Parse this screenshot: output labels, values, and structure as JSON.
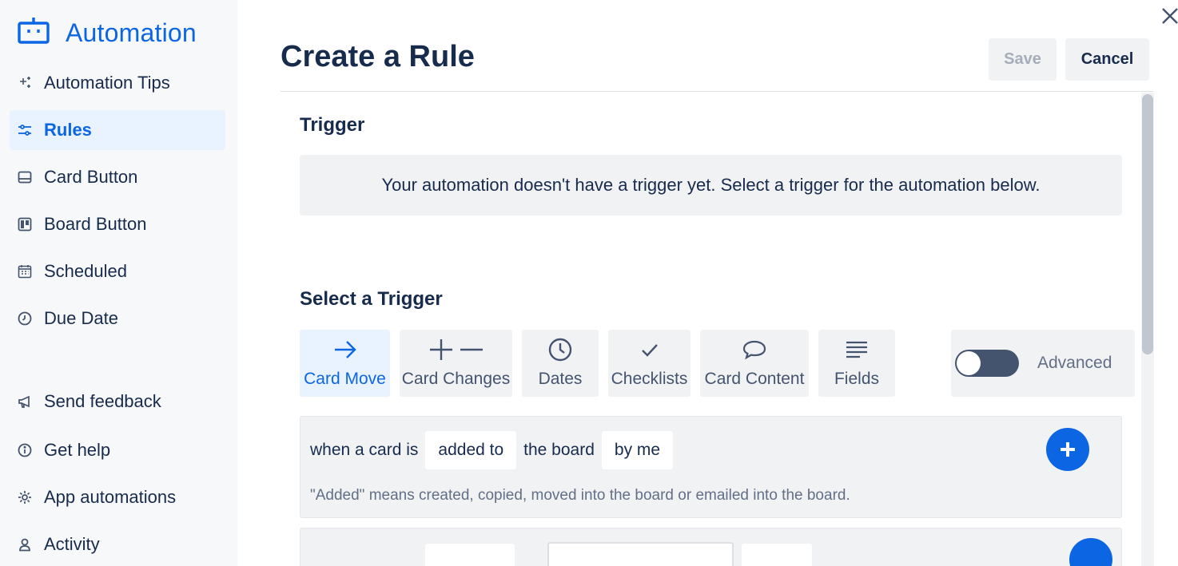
{
  "sidebar": {
    "brand": {
      "title": "Automation",
      "icon": "robot-icon"
    },
    "items": [
      {
        "label": "Automation Tips",
        "icon": "sparkles-icon"
      },
      {
        "label": "Rules",
        "icon": "sliders-icon",
        "active": true
      },
      {
        "label": "Card Button",
        "icon": "card-button-icon"
      },
      {
        "label": "Board Button",
        "icon": "board-icon"
      },
      {
        "label": "Scheduled",
        "icon": "calendar-icon"
      },
      {
        "label": "Due Date",
        "icon": "clock-icon"
      },
      {
        "label": "Send feedback",
        "icon": "megaphone-icon"
      },
      {
        "label": "Get help",
        "icon": "info-icon"
      },
      {
        "label": "App automations",
        "icon": "gear-icon"
      },
      {
        "label": "Activity",
        "icon": "person-icon"
      }
    ]
  },
  "header": {
    "title": "Create a Rule",
    "save_label": "Save",
    "cancel_label": "Cancel"
  },
  "trigger": {
    "heading": "Trigger",
    "empty_message": "Your automation doesn't have a trigger yet. Select a trigger for the automation below."
  },
  "select_trigger": {
    "heading": "Select a Trigger",
    "tabs": [
      {
        "label": "Card Move",
        "icon": "arrow-right-icon",
        "selected": true
      },
      {
        "label": "Card Changes",
        "icon": "plus-minus-icon"
      },
      {
        "label": "Dates",
        "icon": "clock-icon"
      },
      {
        "label": "Checklists",
        "icon": "checkmark-icon"
      },
      {
        "label": "Card Content",
        "icon": "speech-bubble-icon"
      },
      {
        "label": "Fields",
        "icon": "lines-icon"
      }
    ],
    "advanced_label": "Advanced",
    "advanced_enabled": false
  },
  "rules": [
    {
      "prefix": "when a card is",
      "option1": "added to",
      "middle": "the board",
      "option2": "by me",
      "note": "\"Added\" means created, copied, moved into the board or emailed into the board."
    }
  ],
  "colors": {
    "accent": "#0c66e4",
    "text": "#172b4d",
    "subtle_bg": "#f1f2f4",
    "sidebar_bg": "#f7f8f9",
    "active_bg": "#e9f2ff"
  }
}
